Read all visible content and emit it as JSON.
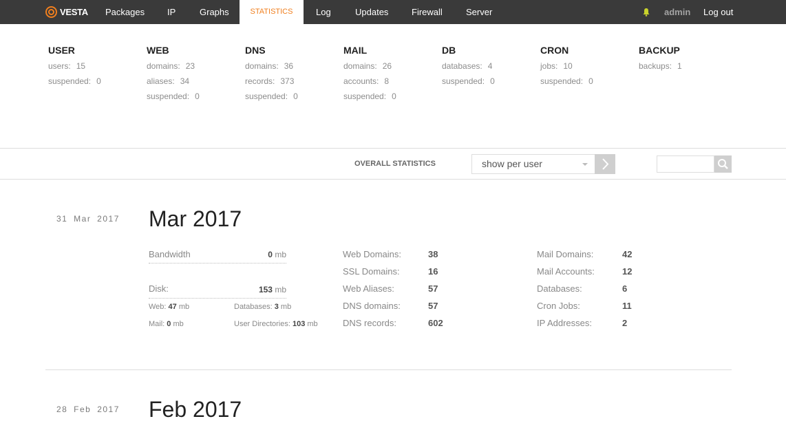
{
  "app": {
    "brand": "VESTA"
  },
  "nav": {
    "items": [
      {
        "label": "Packages"
      },
      {
        "label": "IP"
      },
      {
        "label": "Graphs"
      },
      {
        "label": "STATISTICS"
      },
      {
        "label": "Log"
      },
      {
        "label": "Updates"
      },
      {
        "label": "Firewall"
      },
      {
        "label": "Server"
      }
    ],
    "user": "admin",
    "logout": "Log out"
  },
  "summary": [
    {
      "title": "USER",
      "rows": [
        {
          "k": "users:",
          "v": "15"
        },
        {
          "k": "suspended:",
          "v": "0"
        }
      ]
    },
    {
      "title": "WEB",
      "rows": [
        {
          "k": "domains:",
          "v": "23"
        },
        {
          "k": "aliases:",
          "v": "34"
        },
        {
          "k": "suspended:",
          "v": "0"
        }
      ]
    },
    {
      "title": "DNS",
      "rows": [
        {
          "k": "domains:",
          "v": "36"
        },
        {
          "k": "records:",
          "v": "373"
        },
        {
          "k": "suspended:",
          "v": "0"
        }
      ]
    },
    {
      "title": "MAIL",
      "rows": [
        {
          "k": "domains:",
          "v": "26"
        },
        {
          "k": "accounts:",
          "v": "8"
        },
        {
          "k": "suspended:",
          "v": "0"
        }
      ]
    },
    {
      "title": "DB",
      "rows": [
        {
          "k": "databases:",
          "v": "4"
        },
        {
          "k": "suspended:",
          "v": "0"
        }
      ]
    },
    {
      "title": "CRON",
      "rows": [
        {
          "k": "jobs:",
          "v": "10"
        },
        {
          "k": "suspended:",
          "v": "0"
        }
      ]
    },
    {
      "title": "BACKUP",
      "rows": [
        {
          "k": "backups:",
          "v": "1"
        }
      ]
    }
  ],
  "toolbar": {
    "overall_label": "OVERALL STATISTICS",
    "select_value": "show per user"
  },
  "months": [
    {
      "date": "31 Mar 2017",
      "title": "Mar 2017",
      "bandwidth_label": "Bandwidth",
      "bandwidth_value": "0",
      "disk_label": "Disk:",
      "disk_value": "153",
      "unit": "mb",
      "web_label": "Web:",
      "web_value": "47",
      "db_label": "Databases:",
      "db_value": "3",
      "mail_label": "Mail:",
      "mail_value": "0",
      "udir_label": "User Directories:",
      "udir_value": "103",
      "col1": [
        {
          "k": "Web Domains:",
          "v": "38"
        },
        {
          "k": "SSL Domains:",
          "v": "16"
        },
        {
          "k": "Web Aliases:",
          "v": "57"
        },
        {
          "k": "DNS domains:",
          "v": "57"
        },
        {
          "k": "DNS records:",
          "v": "602"
        }
      ],
      "col2": [
        {
          "k": "Mail Domains:",
          "v": "42"
        },
        {
          "k": "Mail Accounts:",
          "v": "12"
        },
        {
          "k": "Databases:",
          "v": "6"
        },
        {
          "k": "Cron Jobs:",
          "v": "11"
        },
        {
          "k": "IP Addresses:",
          "v": "2"
        }
      ]
    },
    {
      "date": "28 Feb 2017",
      "title": "Feb 2017"
    }
  ],
  "colors": {
    "accent": "#f07f1e",
    "topbar": "#3a3a3a",
    "bell": "#c9d32c"
  }
}
